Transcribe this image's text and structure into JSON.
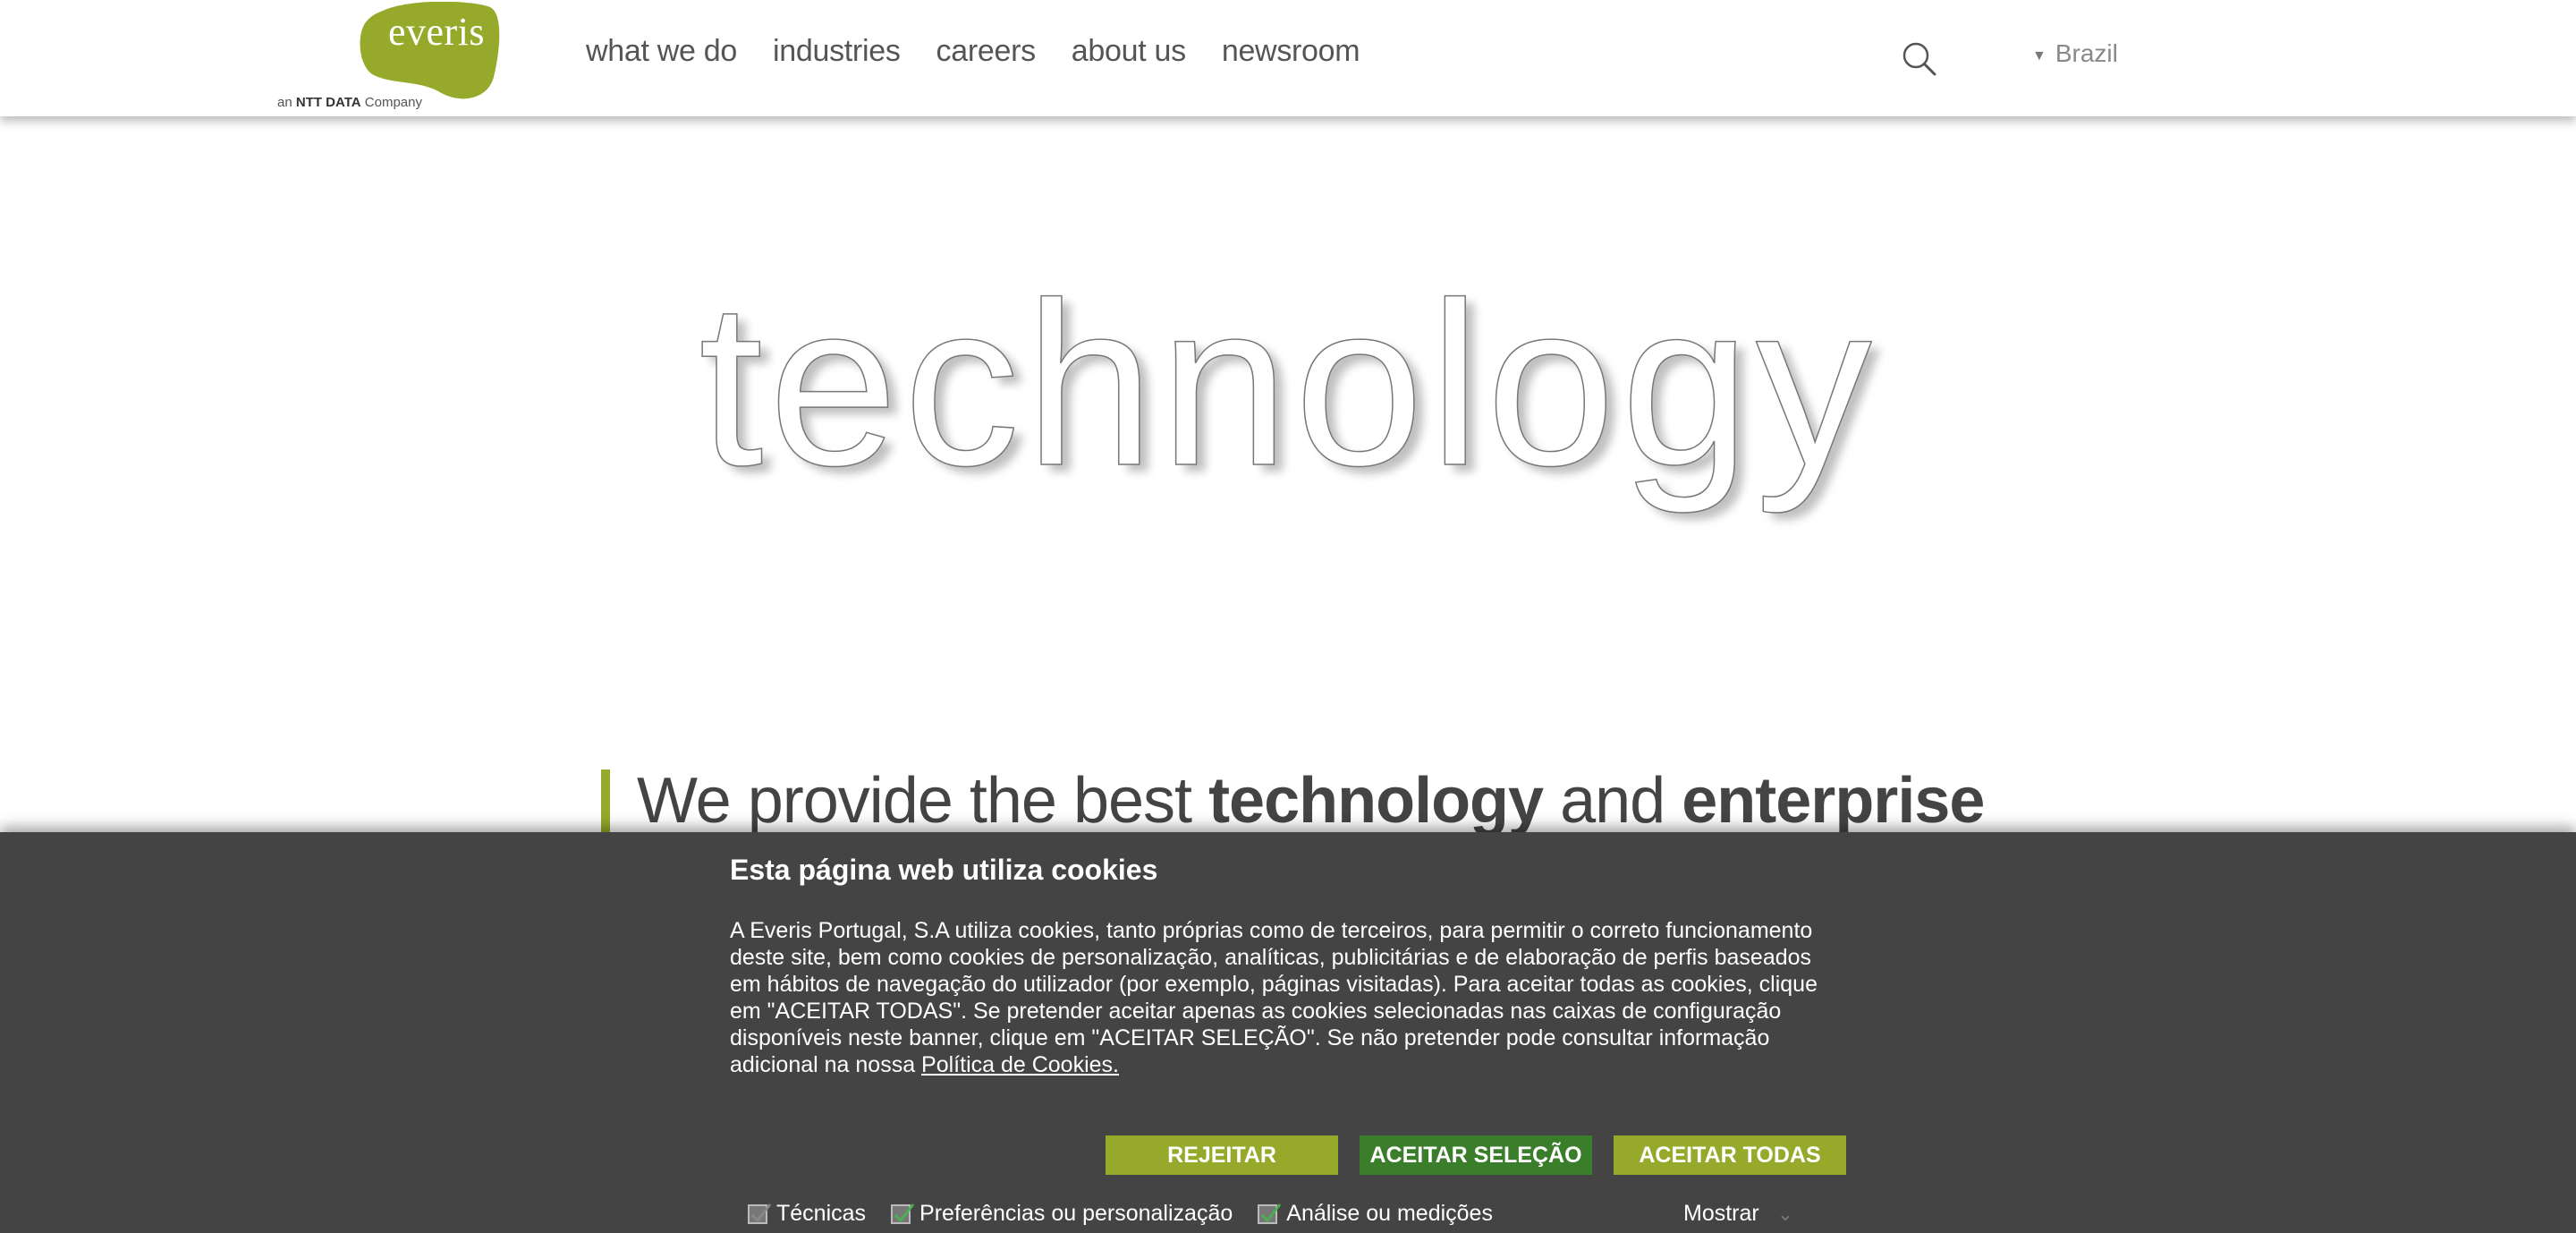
{
  "header": {
    "logo_word": "everis",
    "logo_sub_prefix": "an",
    "logo_sub_brand": "NTT DATA",
    "logo_sub_suffix": "Company",
    "nav": [
      "what we do",
      "industries",
      "careers",
      "about us",
      "newsroom"
    ],
    "country": "Brazil"
  },
  "hero": {
    "word": "technology",
    "tagline_prefix": "We provide the best",
    "tagline_bold1": "technology",
    "tagline_mid": "and",
    "tagline_bold2": "enterprise"
  },
  "cookie": {
    "title": "Esta página web utiliza cookies",
    "body": "A Everis Portugal, S.A utiliza cookies, tanto próprias como de terceiros, para permitir o correto funcionamento deste site, bem como cookies de personalização, analíticas, publicitárias e de elaboração de perfis baseados em hábitos de navegação do utilizador (por exemplo, páginas visitadas). Para aceitar todas as cookies, clique em \"ACEITAR TODAS\". Se pretender aceitar apenas as cookies selecionadas nas caixas de configuração disponíveis neste banner, clique em \"ACEITAR SELEÇÃO\". Se não pretender pode consultar informação adicional na nossa",
    "policy_link": "Política de Cookies. ",
    "dash": " ",
    "buttons": {
      "reject": "REJEITAR",
      "accept_selection": "ACEITAR SELEÇÃO",
      "accept_all": "ACEITAR TODAS"
    },
    "options": [
      {
        "label": "Técnicas",
        "checked": true
      },
      {
        "label": "Preferências ou personalização",
        "checked": true
      },
      {
        "label": "Análise ou medições",
        "checked": true
      }
    ],
    "show_label": "Mostrar"
  },
  "colors": {
    "brand_green": "#96a92a",
    "dark_green": "#3a7d2a",
    "banner_bg": "#444444"
  }
}
